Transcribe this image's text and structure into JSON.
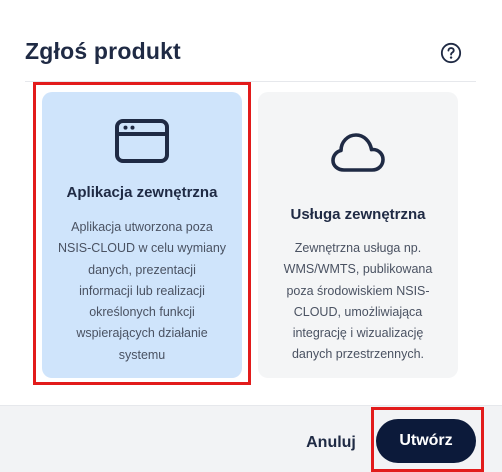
{
  "dialog": {
    "title": "Zgłoś produkt",
    "help_icon": "question-circle-icon"
  },
  "cards": [
    {
      "icon": "browser-window-icon",
      "title": "Aplikacja zewnętrzna",
      "description_lines": [
        "Aplikacja utworzona poza",
        "NSIS-CLOUD w celu wymiany",
        "danych, prezentacji",
        "informacji lub realizacji",
        "określonych funkcji",
        "wspierających działanie",
        "systemu"
      ],
      "selected": true
    },
    {
      "icon": "cloud-icon",
      "title": "Usługa zewnętrzna",
      "description_lines": [
        "Zewnętrzna usługa np.",
        "WMS/WMTS, publikowana",
        "poza środowiskiem NSIS-",
        "CLOUD, umożliwiająca",
        "integrację i wizualizację",
        "danych przestrzennych."
      ],
      "selected": false
    }
  ],
  "footer": {
    "cancel_label": "Anuluj",
    "create_label": "Utwórz"
  },
  "colors": {
    "selected_card_bg": "#cfe4fb",
    "card_bg": "#f4f5f6",
    "primary_button": "#0c1a3a",
    "highlight": "#e21b1b"
  }
}
